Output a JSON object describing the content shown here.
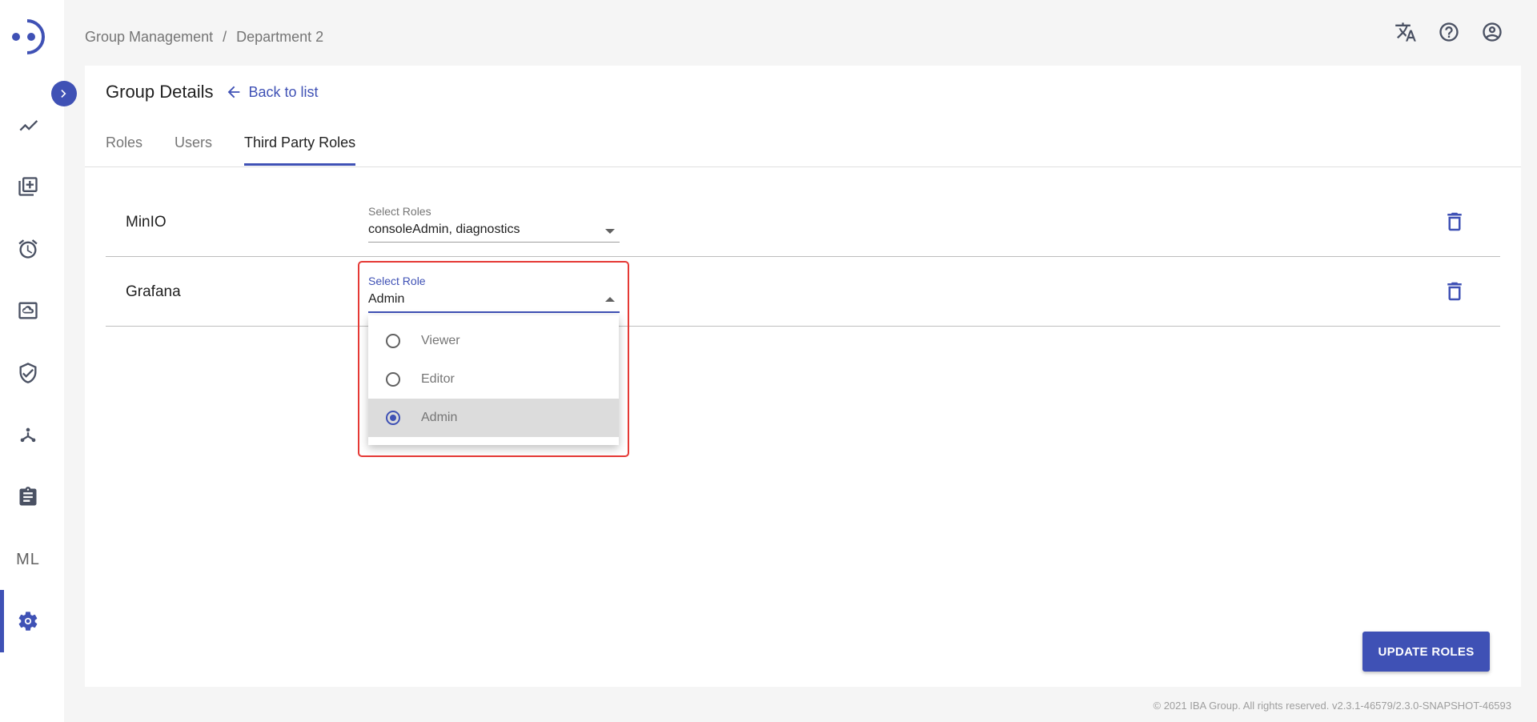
{
  "breadcrumb": {
    "items": [
      "Group Management",
      "Department 2"
    ],
    "separator": "/"
  },
  "header": {
    "icons": [
      "translate-icon",
      "help-icon",
      "account-icon"
    ]
  },
  "sidebar": {
    "icons": [
      "trending-icon",
      "library-add-icon",
      "alarm-icon",
      "cloud-storage-icon",
      "shield-check-icon",
      "network-icon",
      "clipboard-icon",
      "ml-icon",
      "settings-icon"
    ],
    "ml_label": "ML",
    "active_item": "settings-icon"
  },
  "page": {
    "title": "Group Details",
    "back_label": "Back to list"
  },
  "tabs": [
    {
      "label": "Roles",
      "active": false
    },
    {
      "label": "Users",
      "active": false
    },
    {
      "label": "Third Party Roles",
      "active": true
    }
  ],
  "rows": [
    {
      "name": "MinIO",
      "select_label": "Select Roles",
      "value": "consoleAdmin, diagnostics"
    },
    {
      "name": "Grafana",
      "select_label": "Select Role",
      "value": "Admin"
    }
  ],
  "dropdown": {
    "options": [
      "Viewer",
      "Editor",
      "Admin"
    ],
    "selected": "Admin"
  },
  "actions": {
    "update_label": "UPDATE ROLES"
  },
  "footer": {
    "text": "© 2021 IBA Group. All rights reserved. v2.3.1-46579/2.3.0-SNAPSHOT-46593"
  },
  "colors": {
    "accent": "#3f51b5",
    "highlight": "#e53935"
  }
}
